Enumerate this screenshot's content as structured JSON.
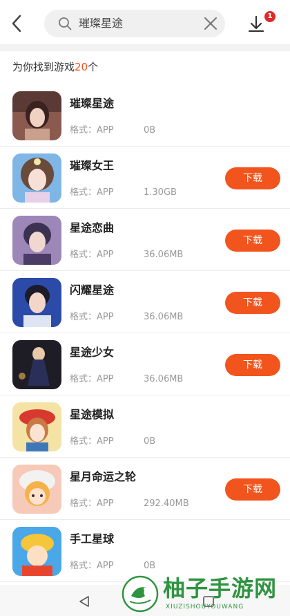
{
  "header": {
    "search_value": "璀璨星途",
    "download_badge": "1"
  },
  "summary": {
    "prefix": "为你找到游戏",
    "count": "20",
    "suffix": "个"
  },
  "games": [
    {
      "name": "璀璨星途",
      "format": "格式：APP",
      "size": "0B",
      "button": ""
    },
    {
      "name": "璀璨女王",
      "format": "格式：APP",
      "size": "1.30GB",
      "button": "下载"
    },
    {
      "name": "星途恋曲",
      "format": "格式：APP",
      "size": "36.06MB",
      "button": "下载"
    },
    {
      "name": "闪耀星途",
      "format": "格式：APP",
      "size": "36.06MB",
      "button": "下载"
    },
    {
      "name": "星途少女",
      "format": "格式：APP",
      "size": "36.06MB",
      "button": "下载"
    },
    {
      "name": "星途模拟",
      "format": "格式：APP",
      "size": "0B",
      "button": ""
    },
    {
      "name": "星月命运之轮",
      "format": "格式：APP",
      "size": "292.40MB",
      "button": "下载"
    },
    {
      "name": "手工星球",
      "format": "格式：APP",
      "size": "0B",
      "button": ""
    }
  ],
  "watermark": {
    "title": "柚子手游网",
    "subtitle": "XIUZISHOUYOUWANG"
  },
  "colors": {
    "accent": "#f2541e",
    "badge": "#e02a2a",
    "watermark": "#2f9440"
  }
}
